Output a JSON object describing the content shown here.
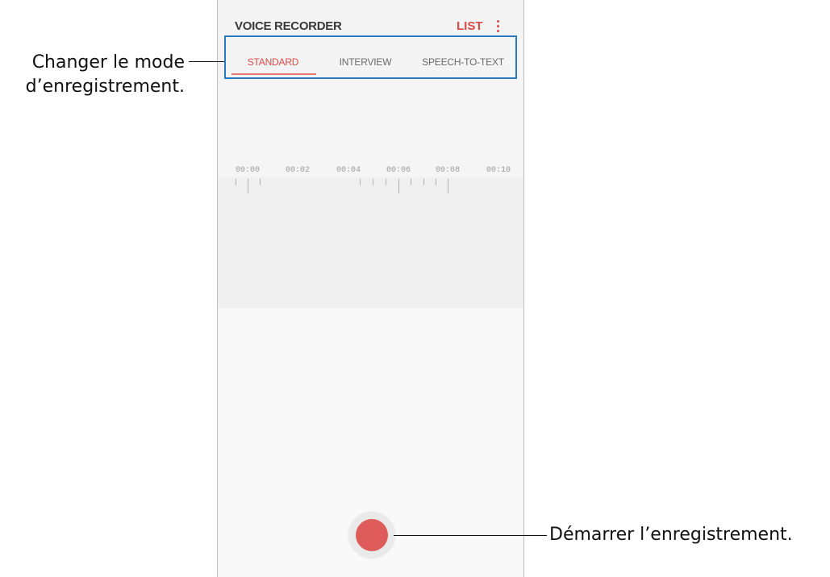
{
  "app": {
    "title": "VOICE RECORDER",
    "list_label": "LIST",
    "more_icon": "more-vertical-icon",
    "accent_color": "#d84a48"
  },
  "tabs": [
    {
      "label": "STANDARD",
      "active": true
    },
    {
      "label": "INTERVIEW",
      "active": false
    },
    {
      "label": "SPEECH-TO-TEXT",
      "active": false
    }
  ],
  "timeline": {
    "ticks": [
      "00:00",
      "00:02",
      "00:04",
      "00:06",
      "00:08",
      "00:10"
    ]
  },
  "record_button": {
    "icon": "record-icon",
    "color": "#de5c5a"
  },
  "annotations": {
    "mode_line1": "Changer le mode",
    "mode_line2": "d’enregistrement.",
    "start": "Démarrer l’enregistrement.",
    "highlight_color": "#2a7bbd"
  }
}
